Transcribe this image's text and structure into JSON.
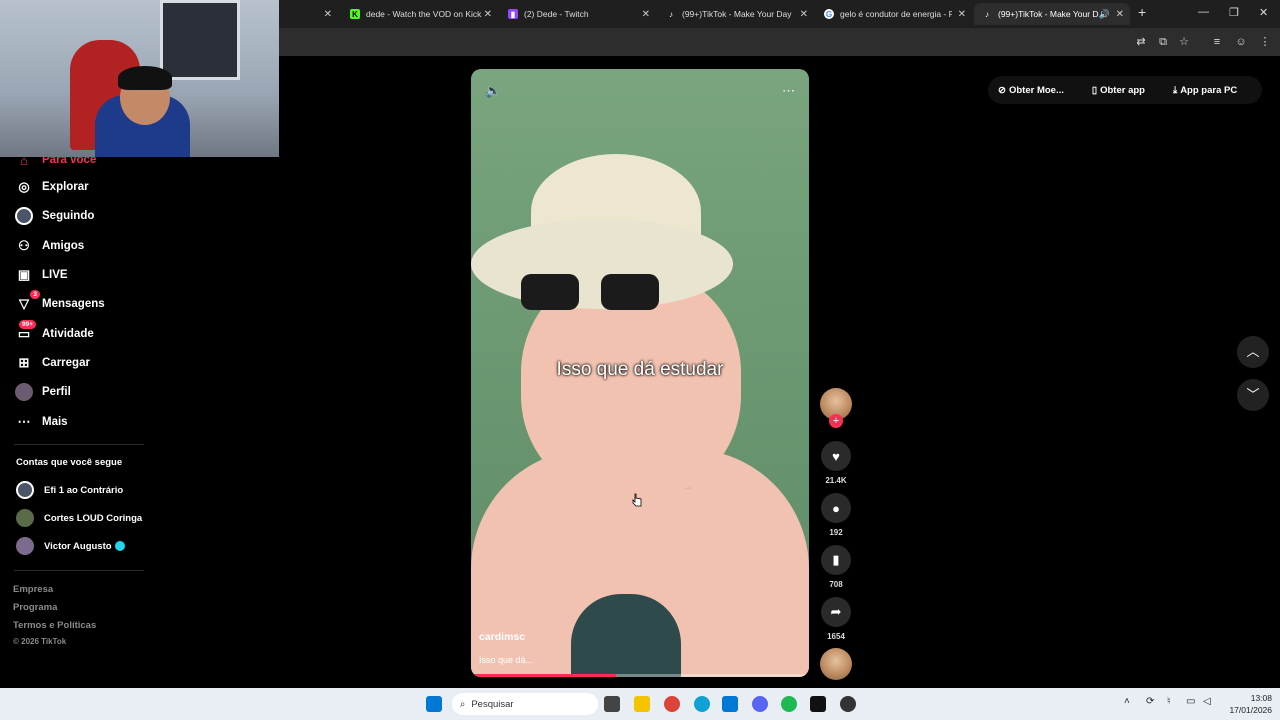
{
  "browser": {
    "tabs": [
      {
        "label": "dede - Watch the VOD on Kick",
        "favicon": "kick-icon",
        "color": "#53fc18"
      },
      {
        "label": "(2) Dede - Twitch",
        "favicon": "twitch-icon",
        "color": "#9146ff"
      },
      {
        "label": "(99+)TikTok - Make Your Day",
        "favicon": "tiktok-icon",
        "color": "#ffffff"
      },
      {
        "label": "gelo é condutor de energia - Pe",
        "favicon": "google-icon",
        "color": "#4285f4"
      },
      {
        "label": "(99+)TikTok - Make Your D",
        "favicon": "tiktok-icon",
        "color": "#ffffff"
      }
    ],
    "new_tab": "+",
    "window_controls": {
      "minimize": "—",
      "maximize": "❐",
      "close": "✕"
    }
  },
  "sidebar": {
    "partial_item": "Para você",
    "items": [
      {
        "label": "Explorar",
        "icon": "compass-icon"
      },
      {
        "label": "Seguindo",
        "icon": "following-icon"
      },
      {
        "label": "Amigos",
        "icon": "friends-icon"
      },
      {
        "label": "LIVE",
        "icon": "live-icon"
      },
      {
        "label": "Mensagens",
        "icon": "messages-icon",
        "badge": "3"
      },
      {
        "label": "Atividade",
        "icon": "activity-icon",
        "badge": "99+"
      },
      {
        "label": "Carregar",
        "icon": "upload-icon"
      },
      {
        "label": "Perfil",
        "icon": "profile-icon"
      },
      {
        "label": "Mais",
        "icon": "more-icon"
      }
    ],
    "following_title": "Contas que você segue",
    "following": [
      {
        "name": "Efi 1 ao Contrário",
        "verified": false
      },
      {
        "name": "Cortes LOUD Coringa",
        "verified": false
      },
      {
        "name": "Victor Augusto",
        "verified": true
      }
    ],
    "footer": [
      "Empresa",
      "Programa",
      "Termos e Políticas"
    ],
    "copyright": "© 2026 TikTok"
  },
  "video": {
    "caption": "Isso que dá estudar",
    "author": "cardimsc",
    "description": "Isso que dá...",
    "progress": 0.43
  },
  "actions": {
    "likes": "21.4K",
    "comments": "192",
    "saves": "708",
    "shares": "1654"
  },
  "topright": {
    "coins": "Obter Moe...",
    "app": "Obter app",
    "pc_app": "App para PC"
  },
  "taskbar": {
    "search_placeholder": "Pesquisar",
    "time": "13:08",
    "date": "17/01/2026"
  },
  "colors": {
    "accent": "#fe2c55",
    "verified": "#20d5ec"
  }
}
